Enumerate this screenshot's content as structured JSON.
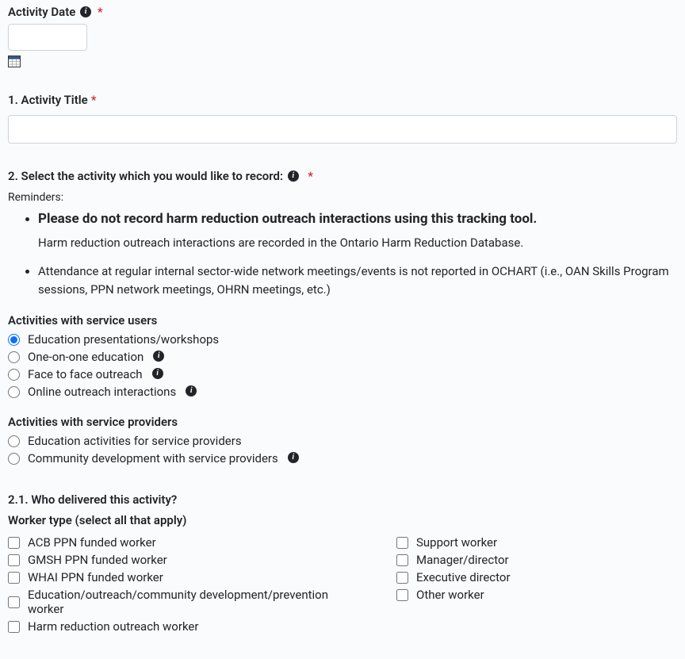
{
  "q0": {
    "label": "Activity Date",
    "value": ""
  },
  "q1": {
    "label": "1. Activity Title",
    "value": ""
  },
  "q2": {
    "label": "2. Select the activity which you would like to record:",
    "remindersLabel": "Reminders:",
    "reminderBold": "Please do not record harm reduction outreach interactions using this tracking tool.",
    "reminderSub": "Harm reduction outreach interactions are recorded in the Ontario Harm Reduction Database.",
    "reminder2": "Attendance at regular internal sector-wide network meetings/events is not reported in OCHART (i.e., OAN Skills Program sessions, PPN network meetings, OHRN meetings, etc.)",
    "groupA": "Activities with service users",
    "optA": [
      "Education presentations/workshops",
      "One-on-one education",
      "Face to face outreach",
      "Online outreach interactions"
    ],
    "groupB": "Activities with service providers",
    "optB": [
      "Education activities for service providers",
      "Community development with service providers"
    ]
  },
  "q21": {
    "label": "2.1. Who delivered this activity?",
    "sublabel": "Worker type (select all that apply)",
    "colA": [
      "ACB PPN funded worker",
      "GMSH PPN funded worker",
      "WHAI PPN funded worker",
      "Education/outreach/community development/prevention worker",
      "Harm reduction outreach worker"
    ],
    "colB": [
      "Support worker",
      "Manager/director",
      "Executive director",
      "Other worker"
    ]
  }
}
